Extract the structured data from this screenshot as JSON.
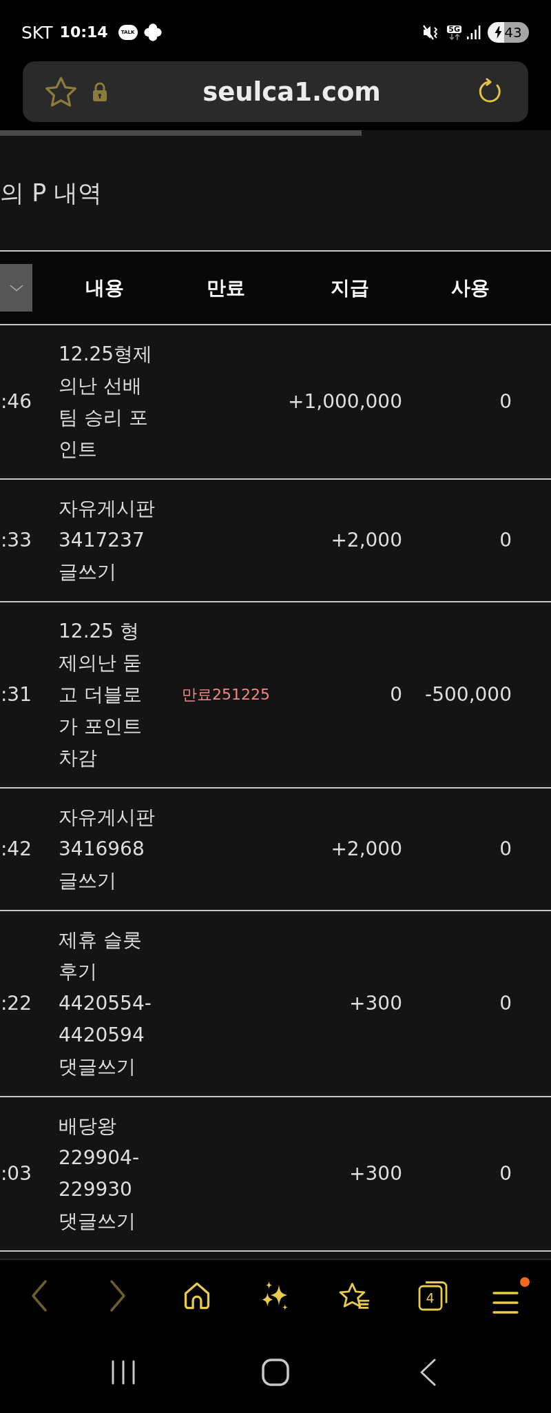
{
  "status_bar": {
    "carrier": "SKT",
    "time": "10:14",
    "chat_badge": "TALK",
    "network": "5G",
    "battery": "43"
  },
  "address_bar": {
    "url": "seulca1.com"
  },
  "page": {
    "title": "의 P 내역"
  },
  "table": {
    "columns": [
      "내용",
      "만료",
      "지급",
      "사용"
    ],
    "rows": [
      {
        "column_1": ":46",
        "content": "12.25형제의난 선배팀 승리 포인트",
        "paid": "+1,000,000",
        "used": "0"
      },
      {
        "column_1": ":33",
        "content": "자유게시판 3417237 글쓰기",
        "paid": "+2,000",
        "used": "0"
      },
      {
        "column_1": ":31",
        "content": "12.25 형제의난 둗고 더블로 가 포인트 차감",
        "expiry": "만료251225",
        "paid": "0",
        "used": "-500,000"
      },
      {
        "column_1": ":42",
        "content": "자유게시판 3416968 글쓰기",
        "paid": "+2,000",
        "used": "0"
      },
      {
        "column_1": ":22",
        "content": "제휴 슬롯 후기 4420554-4420594 댓글쓰기",
        "paid": "+300",
        "used": "0"
      },
      {
        "column_1": ":03",
        "content": "배당왕 229904-229930 댓글쓰기",
        "paid": "+300",
        "used": "0"
      }
    ]
  },
  "browser_toolbar": {
    "back": {
      "disabled": true
    },
    "forward": {
      "disabled": true
    },
    "tab_count": "4",
    "menu_notification": true
  }
}
